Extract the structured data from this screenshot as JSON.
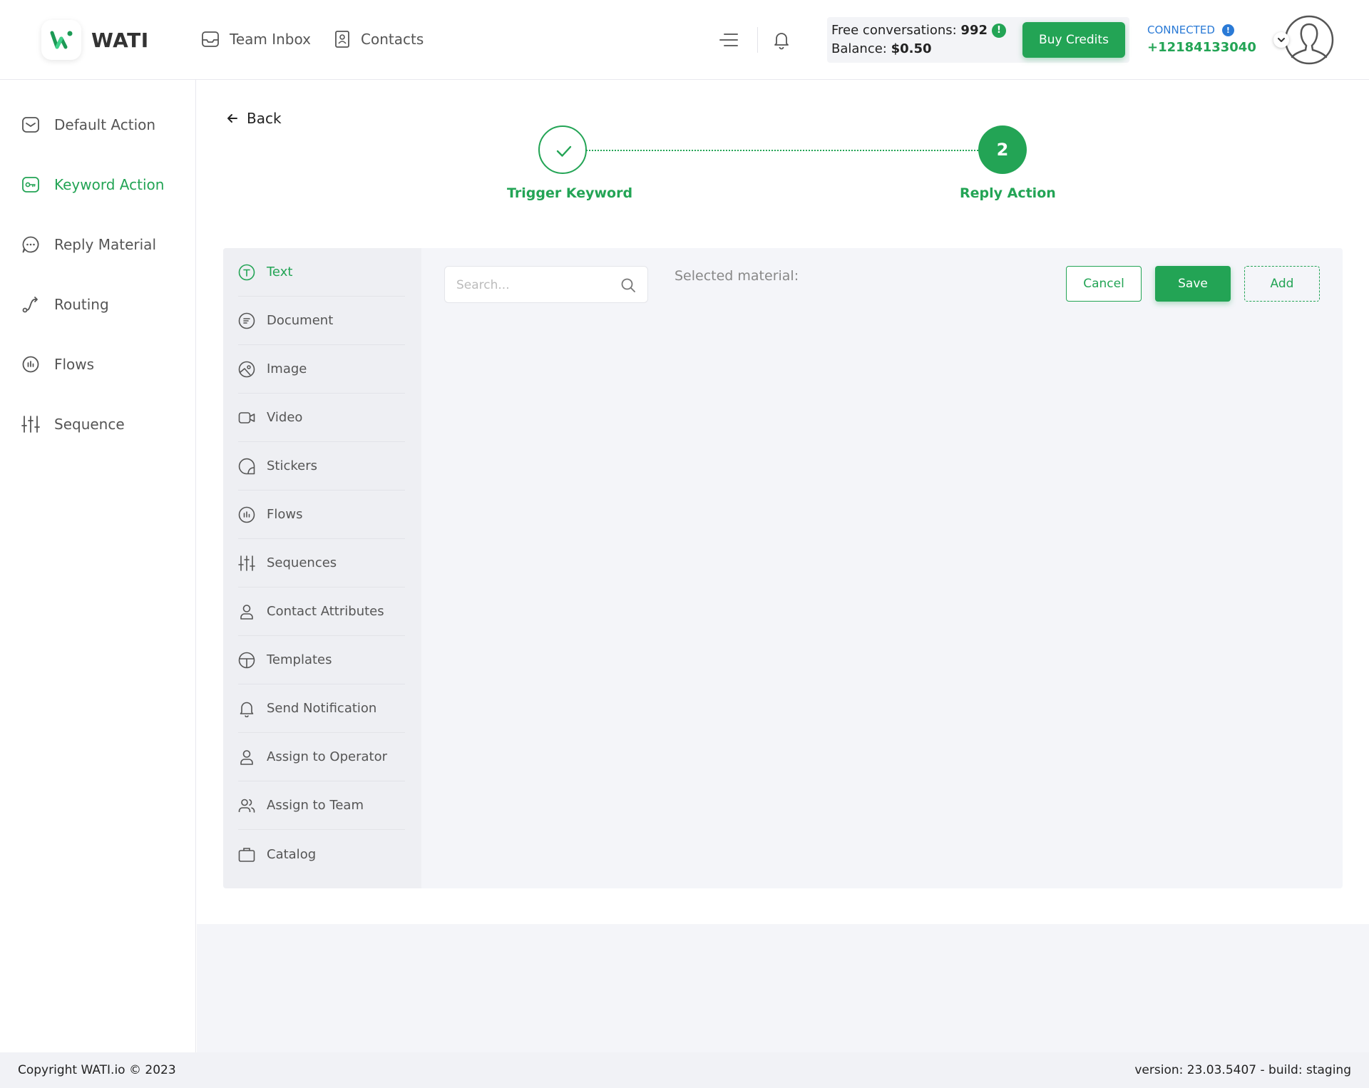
{
  "header": {
    "app_name": "WATI",
    "nav": {
      "team_inbox": "Team Inbox",
      "contacts": "Contacts"
    },
    "credits": {
      "free_label": "Free conversations: ",
      "free_value": "992",
      "balance_label": "Balance: ",
      "balance_value": "$0.50",
      "buy_label": "Buy Credits"
    },
    "connection": {
      "status": "CONNECTED",
      "phone": "+12184133040"
    }
  },
  "sidebar": {
    "items": [
      {
        "label": "Default Action",
        "icon": "inbox-icon"
      },
      {
        "label": "Keyword Action",
        "icon": "key-icon"
      },
      {
        "label": "Reply Material",
        "icon": "chat-bubble-icon"
      },
      {
        "label": "Routing",
        "icon": "route-icon"
      },
      {
        "label": "Flows",
        "icon": "flow-icon"
      },
      {
        "label": "Sequence",
        "icon": "sliders-icon"
      }
    ]
  },
  "main": {
    "back_label": "Back",
    "stepper": {
      "step1_label": "Trigger Keyword",
      "step2_number": "2",
      "step2_label": "Reply Action"
    },
    "materials": [
      "Text",
      "Document",
      "Image",
      "Video",
      "Stickers",
      "Flows",
      "Sequences",
      "Contact Attributes",
      "Templates",
      "Send Notification",
      "Assign to Operator",
      "Assign to Team",
      "Catalog"
    ],
    "search_placeholder": "Search...",
    "selected_material_label": "Selected material:",
    "buttons": {
      "cancel": "Cancel",
      "save": "Save",
      "add": "Add"
    }
  },
  "footer": {
    "copyright": "Copyright WATI.io © 2023",
    "version": "version: 23.03.5407 - build: staging"
  },
  "colors": {
    "accent": "#23a455",
    "info": "#2a7ad6"
  }
}
